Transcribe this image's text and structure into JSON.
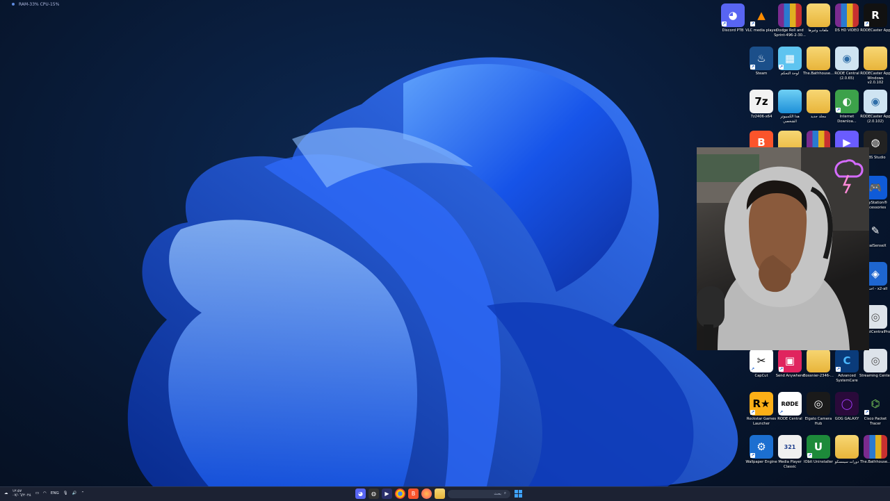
{
  "perf_overlay": {
    "text": "RAM-33%  CPU-15%"
  },
  "desktop_icons": [
    {
      "label": "Discord PTB",
      "glyph": "◕",
      "bg": "#5865f2",
      "color": "#ffffff",
      "shortcut": true
    },
    {
      "label": "VLC media player",
      "glyph": "▲",
      "bg": "transparent",
      "color": "#ff8c00",
      "shortcut": true
    },
    {
      "label": "Dodge Roll and Sprint-496-2-30...",
      "glyph": "",
      "bg": "winrar",
      "color": "#ffffff",
      "shortcut": false
    },
    {
      "label": "ملفات وغيرها",
      "glyph": "",
      "bg": "folder",
      "color": "#ffffff",
      "shortcut": false
    },
    {
      "label": "DS HD VIDEO",
      "glyph": "",
      "bg": "winrar",
      "color": "#ffffff",
      "shortcut": false
    },
    {
      "label": "RODECaster App",
      "glyph": "R",
      "bg": "#111111",
      "color": "#ffffff",
      "shortcut": true
    },
    {
      "label": "Steam",
      "glyph": "♨",
      "bg": "#1b4f8a",
      "color": "#ffffff",
      "shortcut": true
    },
    {
      "label": "لوحة التحكم",
      "glyph": "▦",
      "bg": "#5ec4f0",
      "color": "#ffffff",
      "shortcut": true
    },
    {
      "label": "The.Bathhouse...",
      "glyph": "",
      "bg": "folder",
      "color": "#ffffff",
      "shortcut": false
    },
    {
      "label": "RODE Central (2.0.65)",
      "glyph": "◉",
      "bg": "#cfe4f2",
      "color": "#2f6ea8",
      "shortcut": false
    },
    {
      "label": "RODECaster App Windows v2.0.102",
      "glyph": "",
      "bg": "folder",
      "color": "#ffffff",
      "shortcut": false
    },
    {
      "label": "7z2406-x64",
      "glyph": "7z",
      "bg": "#f2f2f2",
      "color": "#000000",
      "shortcut": false
    },
    {
      "label": "هذا الكمبيوتر الشخصي",
      "glyph": "",
      "bg": "monitor",
      "color": "#ffffff",
      "shortcut": false
    },
    {
      "label": "مجلد جديد",
      "glyph": "",
      "bg": "folder",
      "color": "#ffffff",
      "shortcut": false
    },
    {
      "label": "Internet Downloa...",
      "glyph": "◐",
      "bg": "#3ca14a",
      "color": "#ffffff",
      "shortcut": true
    },
    {
      "label": "RODECaster App (2.0.102)",
      "glyph": "◉",
      "bg": "#cfe4f2",
      "color": "#2f6ea8",
      "shortcut": false
    },
    {
      "label": "",
      "glyph": "B",
      "bg": "#fb542b",
      "color": "#ffffff",
      "shortcut": false
    },
    {
      "label": "",
      "glyph": "",
      "bg": "folder",
      "color": "#ffffff",
      "shortcut": false
    },
    {
      "label": "",
      "glyph": "",
      "bg": "winrar",
      "color": "#ffffff",
      "shortcut": false
    },
    {
      "label": "",
      "glyph": "▶",
      "bg": "#6a5cff",
      "color": "#ffffff",
      "shortcut": false
    },
    {
      "label": "OBS Studio",
      "glyph": "◍",
      "bg": "#222222",
      "color": "#ffffff",
      "shortcut": true
    },
    {
      "label": "PlayStation® Accessories",
      "glyph": "🎮",
      "bg": "#0f5bd8",
      "color": "#ffffff",
      "shortcut": true
    },
    {
      "label": "DualSenseX",
      "glyph": "✎",
      "bg": "transparent",
      "color": "#ffffff",
      "shortcut": false
    },
    {
      "label": "اختصار - x2-all",
      "glyph": "◈",
      "bg": "#1e66d0",
      "color": "#ffffff",
      "shortcut": true
    },
    {
      "label": "AssistCentralPro",
      "glyph": "◎",
      "bg": "#dde3ea",
      "color": "#555555",
      "shortcut": false
    },
    {
      "label": "CapCut",
      "glyph": "✂",
      "bg": "#ffffff",
      "color": "#000000",
      "shortcut": true
    },
    {
      "label": "Send Anywhere",
      "glyph": "▣",
      "bg": "#e0245e",
      "color": "#ffffff",
      "shortcut": true
    },
    {
      "label": "Bossnier-2346-...",
      "glyph": "",
      "bg": "folder",
      "color": "#ffffff",
      "shortcut": false
    },
    {
      "label": "Advanced SystemCare",
      "glyph": "C",
      "bg": "#0a3b7a",
      "color": "#4cb8ff",
      "shortcut": true
    },
    {
      "label": "Streaming Center",
      "glyph": "◎",
      "bg": "#dde3ea",
      "color": "#555555",
      "shortcut": false
    },
    {
      "label": "Rockstar Games Launcher",
      "glyph": "R★",
      "bg": "#fcaf17",
      "color": "#000000",
      "shortcut": true
    },
    {
      "label": "RODE Central",
      "glyph": "RØDE",
      "bg": "#ffffff",
      "color": "#000000",
      "shortcut": true
    },
    {
      "label": "Elgato Camera Hub",
      "glyph": "◎",
      "bg": "#1a1a1a",
      "color": "#ffffff",
      "shortcut": false
    },
    {
      "label": "GOG GALAXY",
      "glyph": "◯",
      "bg": "#2a0a3a",
      "color": "#a23dff",
      "shortcut": false
    },
    {
      "label": "Cisco Packet Tracer",
      "glyph": "⌬",
      "bg": "transparent",
      "color": "#7ccf5a",
      "shortcut": true
    },
    {
      "label": "Wallpaper Engine",
      "glyph": "⚙",
      "bg": "#1c6fd0",
      "color": "#ffffff",
      "shortcut": true
    },
    {
      "label": "Media Player Classic",
      "glyph": "321",
      "bg": "#f0f0f0",
      "color": "#1b3c8c",
      "shortcut": false
    },
    {
      "label": "IObit Uninstaller",
      "glyph": "U",
      "bg": "#1d8a3a",
      "color": "#ffffff",
      "shortcut": true
    },
    {
      "label": "دورات سيمسكو",
      "glyph": "",
      "bg": "folder",
      "color": "#ffffff",
      "shortcut": false
    },
    {
      "label": "The.Bathhouse...",
      "glyph": "",
      "bg": "winrar",
      "color": "#ffffff",
      "shortcut": false
    }
  ],
  "taskbar": {
    "clock_time": "١٢:٥٧",
    "clock_date": "٠٧/٠٦/٢٠٢٤",
    "language": "ENG",
    "search_placeholder": "بحث",
    "pinned_apps": [
      "discord",
      "obs",
      "stream-deck",
      "chrome",
      "brave",
      "firefox",
      "file-explorer",
      "terminal",
      "store"
    ]
  }
}
